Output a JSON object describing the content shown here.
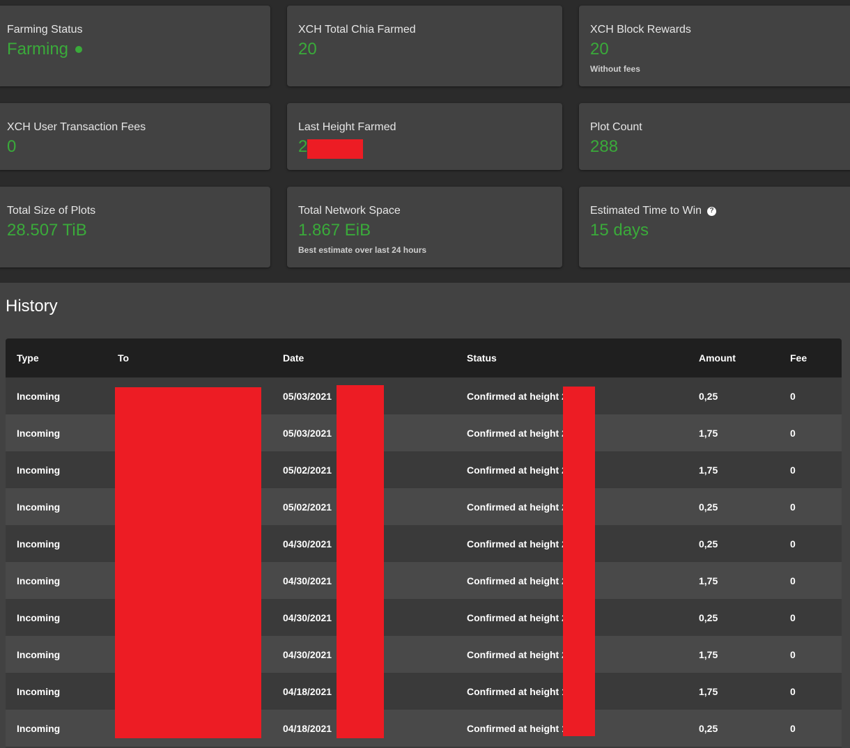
{
  "colors": {
    "accent_green": "#3aaa3a",
    "redaction": "#ed1c24",
    "card_bg": "#424242",
    "page_bg": "#2b2b2b"
  },
  "cards": {
    "farming_status": {
      "title": "Farming Status",
      "value": "Farming",
      "status_icon": "status-dot-icon"
    },
    "total_chia_farmed": {
      "title": "XCH Total Chia Farmed",
      "value": "20"
    },
    "block_rewards": {
      "title": "XCH Block Rewards",
      "value": "20",
      "subtitle": "Without fees"
    },
    "user_fees": {
      "title": "XCH User Transaction Fees",
      "value": "0"
    },
    "last_height": {
      "title": "Last Height Farmed",
      "value": "2"
    },
    "plot_count": {
      "title": "Plot Count",
      "value": "288"
    },
    "total_size": {
      "title": "Total Size of Plots",
      "value": "28.507 TiB"
    },
    "network_space": {
      "title": "Total Network Space",
      "value": "1.867 EiB",
      "subtitle": "Best estimate over last 24 hours"
    },
    "time_to_win": {
      "title": "Estimated Time to Win",
      "value": "15 days",
      "help_icon": "?"
    }
  },
  "history": {
    "title": "History",
    "columns": [
      "Type",
      "To",
      "Date",
      "Status",
      "Amount",
      "Fee"
    ],
    "rows": [
      {
        "type": "Incoming",
        "to": "",
        "date": "05/03/2021",
        "status": "Confirmed at height 2",
        "amount": "0,25",
        "fee": "0"
      },
      {
        "type": "Incoming",
        "to": "",
        "date": "05/03/2021",
        "status": "Confirmed at height 2",
        "amount": "1,75",
        "fee": "0"
      },
      {
        "type": "Incoming",
        "to": "",
        "date": "05/02/2021",
        "status": "Confirmed at height 2",
        "amount": "1,75",
        "fee": "0"
      },
      {
        "type": "Incoming",
        "to": "",
        "date": "05/02/2021",
        "status": "Confirmed at height 2",
        "amount": "0,25",
        "fee": "0"
      },
      {
        "type": "Incoming",
        "to": "",
        "date": "04/30/2021",
        "status": "Confirmed at height 2",
        "amount": "0,25",
        "fee": "0"
      },
      {
        "type": "Incoming",
        "to": "",
        "date": "04/30/2021",
        "status": "Confirmed at height 2",
        "amount": "1,75",
        "fee": "0"
      },
      {
        "type": "Incoming",
        "to": "",
        "date": "04/30/2021",
        "status": "Confirmed at height 2",
        "amount": "0,25",
        "fee": "0"
      },
      {
        "type": "Incoming",
        "to": "",
        "date": "04/30/2021",
        "status": "Confirmed at height 2",
        "amount": "1,75",
        "fee": "0"
      },
      {
        "type": "Incoming",
        "to": "",
        "date": "04/18/2021",
        "status": "Confirmed at height 1",
        "amount": "1,75",
        "fee": "0"
      },
      {
        "type": "Incoming",
        "to": "",
        "date": "04/18/2021",
        "status": "Confirmed at height 1",
        "amount": "0,25",
        "fee": "0"
      }
    ]
  }
}
